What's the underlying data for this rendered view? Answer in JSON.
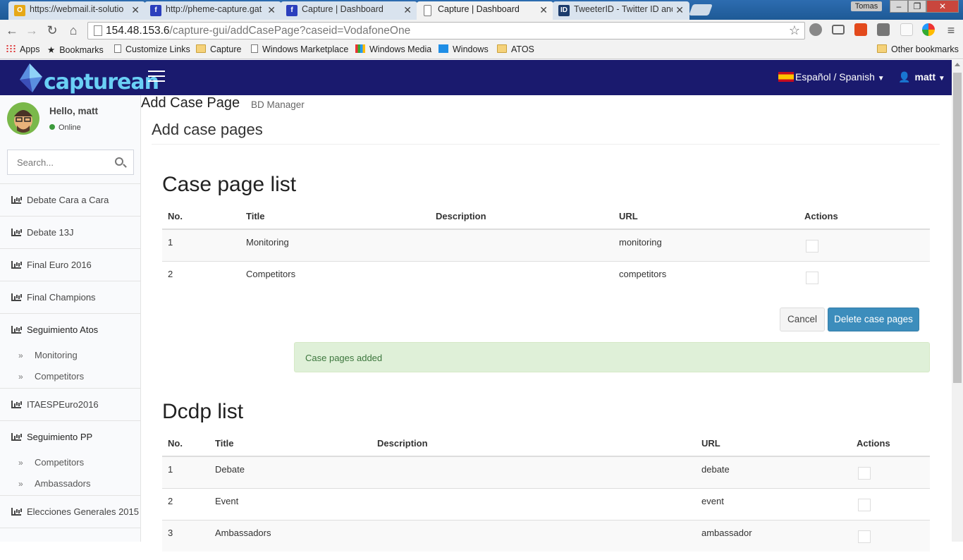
{
  "browser": {
    "tabs": [
      {
        "label": "https://webmail.it-solutio",
        "favicon": "O",
        "color": "#e6a817"
      },
      {
        "label": "http://pheme-capture.gat",
        "favicon": "f",
        "color": "#2b3fbd"
      },
      {
        "label": "Capture | Dashboard",
        "favicon": "f",
        "color": "#2b3fbd"
      },
      {
        "label": "Capture | Dashboard",
        "favicon": "",
        "color": "#ffffff"
      },
      {
        "label": "TweeterID - Twitter ID and",
        "favicon": "ID",
        "color": "#1c3c6c"
      }
    ],
    "os_user": "Tomas",
    "url_host": "154.48.153.6",
    "url_path": "/capture-gui/addCasePage?caseid=VodafoneOne",
    "bookmarks": [
      {
        "label": "Apps",
        "icon": "apps-grid-icon"
      },
      {
        "label": "Bookmarks",
        "icon": "star-icon"
      },
      {
        "label": "Customize Links",
        "icon": "page-icon"
      },
      {
        "label": "Capture",
        "icon": "folder-icon"
      },
      {
        "label": "Windows Marketplace",
        "icon": "page-icon"
      },
      {
        "label": "Windows Media",
        "icon": "windows-media-icon"
      },
      {
        "label": "Windows",
        "icon": "windows-icon"
      },
      {
        "label": "ATOS",
        "icon": "folder-icon"
      }
    ],
    "other_bookmarks": "Other bookmarks"
  },
  "header": {
    "logo_text": "capturean",
    "language": "Español / Spanish",
    "user": "matt",
    "brand_color": "#1a1a6e"
  },
  "sidebar": {
    "greeting": "Hello, matt",
    "status": "Online",
    "search_placeholder": "Search...",
    "items": [
      {
        "label": "Debate Cara a Cara"
      },
      {
        "label": "Debate 13J"
      },
      {
        "label": "Final Euro 2016"
      },
      {
        "label": "Final Champions"
      },
      {
        "label": "Seguimiento Atos",
        "children": [
          "Monitoring",
          "Competitors"
        ]
      },
      {
        "label": "ITAESPEuro2016"
      },
      {
        "label": "Seguimiento PP",
        "children": [
          "Competitors",
          "Ambassadors"
        ]
      },
      {
        "label": "Elecciones Generales 2015"
      }
    ]
  },
  "page": {
    "title": "Add Case Page",
    "subtitle": "BD Manager",
    "box_title": "Add case pages",
    "case_page_list": {
      "heading": "Case page list",
      "columns": [
        "No.",
        "Title",
        "Description",
        "URL",
        "Actions"
      ],
      "rows": [
        {
          "no": "1",
          "title": "Monitoring",
          "description": "",
          "url": "monitoring"
        },
        {
          "no": "2",
          "title": "Competitors",
          "description": "",
          "url": "competitors"
        }
      ]
    },
    "buttons": {
      "cancel": "Cancel",
      "delete": "Delete case pages"
    },
    "alert": "Case pages added",
    "dcdp_list": {
      "heading": "Dcdp list",
      "columns": [
        "No.",
        "Title",
        "Description",
        "URL",
        "Actions"
      ],
      "rows": [
        {
          "no": "1",
          "title": "Debate",
          "description": "",
          "url": "debate"
        },
        {
          "no": "2",
          "title": "Event",
          "description": "",
          "url": "event"
        },
        {
          "no": "3",
          "title": "Ambassadors",
          "description": "",
          "url": "ambassador"
        }
      ]
    }
  }
}
